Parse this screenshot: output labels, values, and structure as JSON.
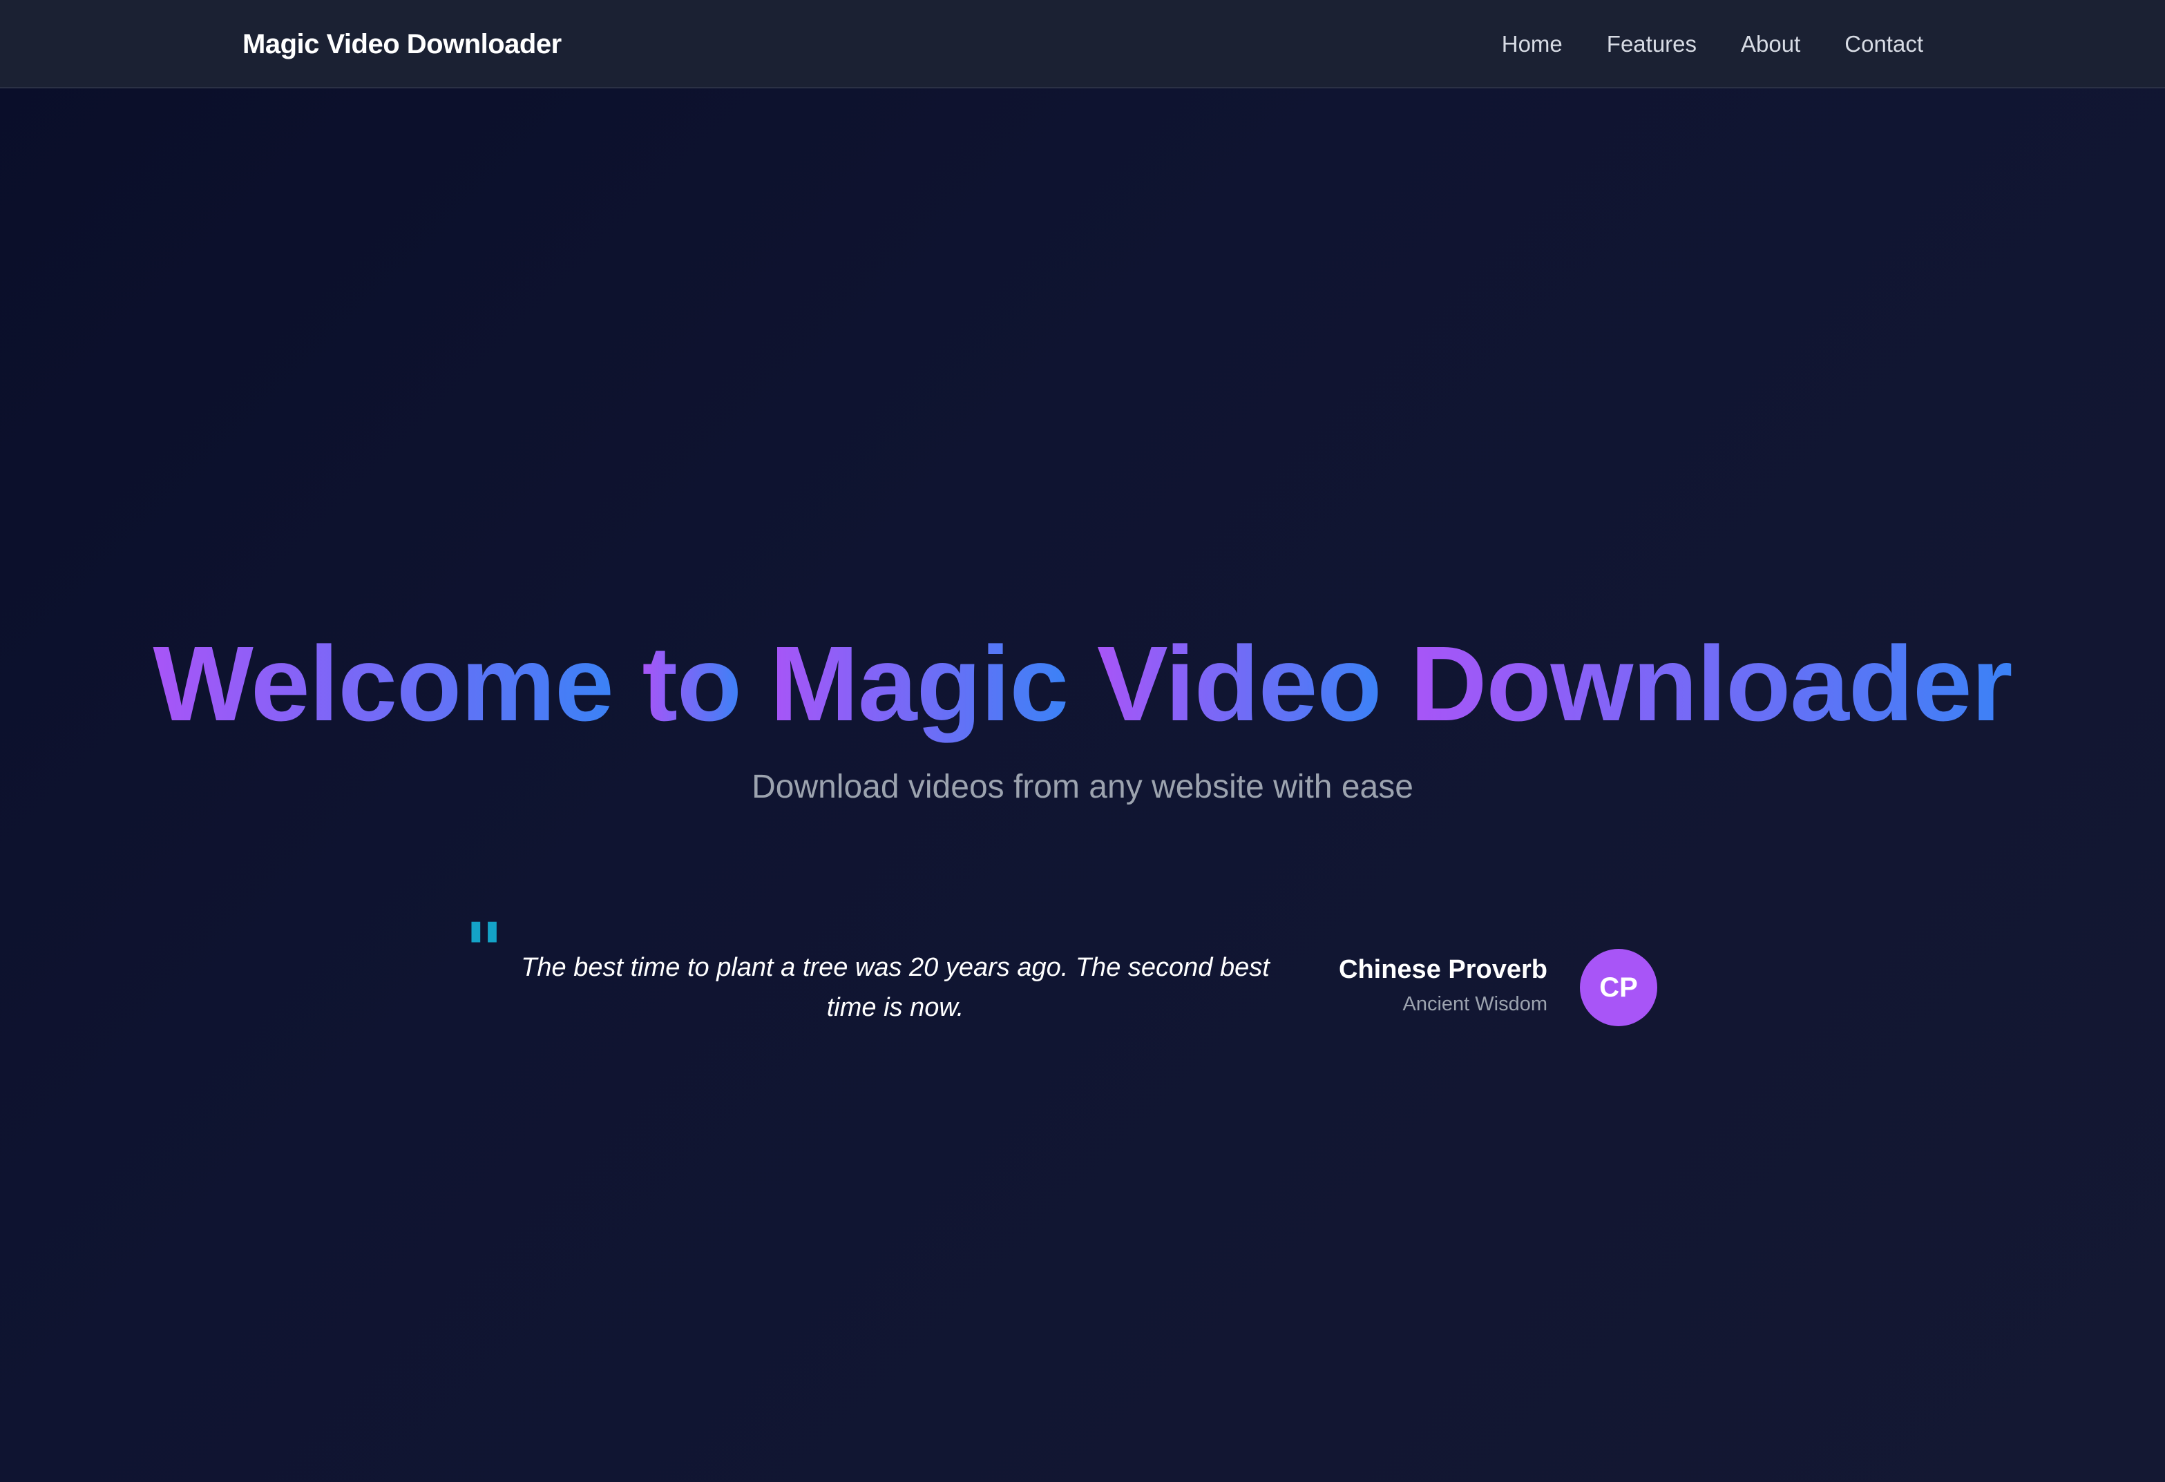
{
  "navbar": {
    "brand": "Magic Video Downloader",
    "links": [
      "Home",
      "Features",
      "About",
      "Contact"
    ]
  },
  "hero": {
    "title_words": [
      "Welcome",
      "to",
      "Magic",
      "Video",
      "Downloader"
    ],
    "subtitle": "Download videos from any website with ease"
  },
  "testimonial": {
    "quote_mark": "\"",
    "quote": "The best time to plant a tree was 20 years ago. The second best time is now.",
    "author_name": "Chinese Proverb",
    "author_role": "Ancient Wisdom",
    "avatar_initials": "CP"
  },
  "colors": {
    "navbar_bg": "#1b2133",
    "page_bg": "#0f1431",
    "gradient_start": "#a855f7",
    "gradient_end": "#3b82f6",
    "quote_mark": "#14a3c7",
    "avatar_bg": "#a855f7"
  }
}
